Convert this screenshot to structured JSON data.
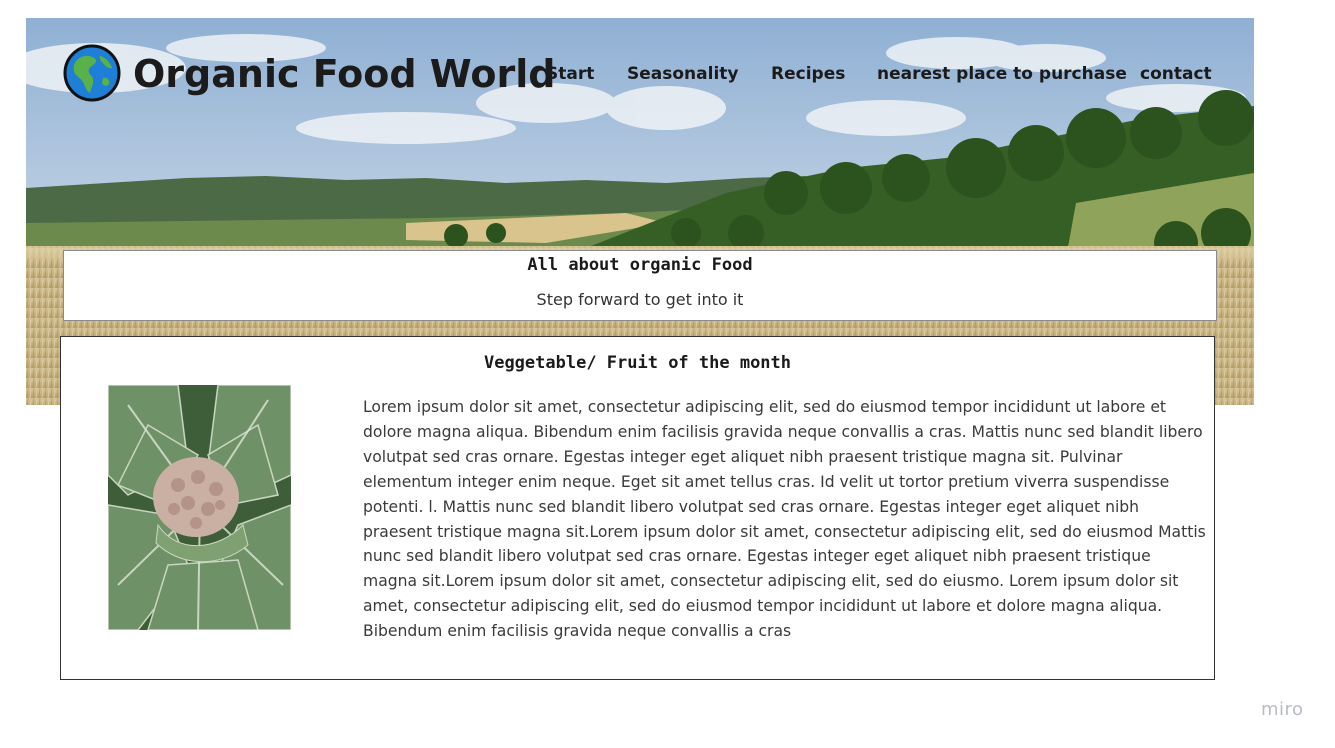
{
  "header": {
    "site_title": "Organic Food World",
    "logo_icon": "globe-americas-icon"
  },
  "nav": {
    "items": [
      {
        "label": "Start"
      },
      {
        "label": "Seasonality"
      },
      {
        "label": "Recipes"
      },
      {
        "label": "nearest place to purchase"
      },
      {
        "label": "contact"
      }
    ]
  },
  "intro": {
    "heading": "All about organic Food",
    "subheading": "Step forward to get into it"
  },
  "month_feature": {
    "heading": "Veggetable/ Fruit of the month",
    "image_icon": "cauliflower-photo",
    "body": "Lorem ipsum dolor sit amet, consectetur adipiscing elit, sed do eiusmod tempor incididunt ut labore et dolore magna aliqua. Bibendum enim facilisis gravida neque convallis a cras. Mattis nunc sed blandit libero volutpat sed cras ornare. Egestas integer eget aliquet nibh praesent tristique magna sit. Pulvinar elementum integer enim neque. Eget sit amet tellus cras. Id velit ut tortor pretium viverra suspendisse potenti. l. Mattis nunc sed blandit libero volutpat sed cras ornare. Egestas integer eget aliquet nibh praesent tristique magna sit.Lorem ipsum dolor sit amet, consectetur adipiscing elit, sed do eiusmod Mattis nunc sed blandit libero volutpat sed cras ornare. Egestas integer eget aliquet nibh praesent tristique magna sit.Lorem ipsum dolor sit amet, consectetur adipiscing elit, sed do eiusmo. Lorem ipsum dolor sit amet, consectetur adipiscing elit, sed do eiusmod tempor incididunt ut labore et dolore magna aliqua. Bibendum enim facilisis gravida neque convallis a cras"
  },
  "watermark": "miro",
  "colors": {
    "sky": "#a9c3de",
    "forest": "#3c6b2a",
    "wheat": "#c9b27a",
    "text_dark": "#1b1b1b"
  }
}
